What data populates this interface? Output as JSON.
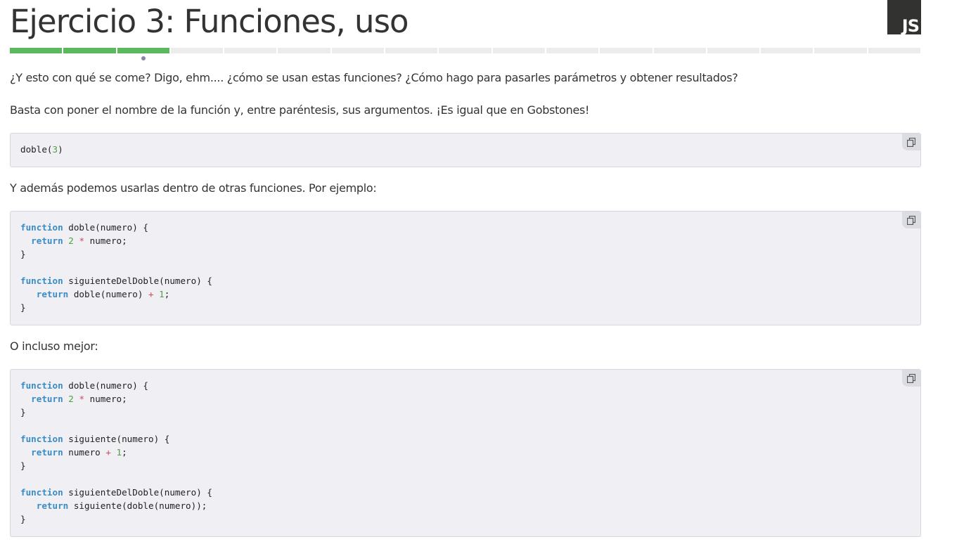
{
  "header": {
    "title": "Ejercicio 3: Funciones, uso",
    "language_badge": "JS"
  },
  "progress": {
    "total_steps": 17,
    "completed_steps": 3,
    "current_step": 3,
    "done_color": "#5cb85c",
    "pending_color": "#ececec"
  },
  "content": {
    "intro": "¿Y esto con qué se come? Digo, ehm.... ¿cómo se usan estas funciones? ¿Cómo hago para pasarles parámetros y obtener resultados?",
    "explanation": "Basta con poner el nombre de la función y, entre paréntesis, sus argumentos. ¡Es igual que en Gobstones!",
    "example_intro": "Y además podemos usarlas dentro de otras funciones. Por ejemplo:",
    "better_intro": "O incluso mejor:"
  },
  "code_blocks": [
    {
      "id": "call",
      "lines": [
        [
          [
            "plain",
            "doble("
          ],
          [
            "num",
            "3"
          ],
          [
            "plain",
            ")"
          ]
        ]
      ]
    },
    {
      "id": "example",
      "lines": [
        [
          [
            "kw",
            "function"
          ],
          [
            "plain",
            " doble(numero) {"
          ]
        ],
        [
          [
            "plain",
            "  "
          ],
          [
            "kw",
            "return"
          ],
          [
            "plain",
            " "
          ],
          [
            "num",
            "2"
          ],
          [
            "plain",
            " "
          ],
          [
            "op",
            "*"
          ],
          [
            "plain",
            " numero;"
          ]
        ],
        [
          [
            "plain",
            "}"
          ]
        ],
        [
          [
            "plain",
            ""
          ]
        ],
        [
          [
            "kw",
            "function"
          ],
          [
            "plain",
            " siguienteDelDoble(numero) {"
          ]
        ],
        [
          [
            "plain",
            "   "
          ],
          [
            "kw",
            "return"
          ],
          [
            "plain",
            " doble(numero) "
          ],
          [
            "op",
            "+"
          ],
          [
            "plain",
            " "
          ],
          [
            "num",
            "1"
          ],
          [
            "plain",
            ";"
          ]
        ],
        [
          [
            "plain",
            "}"
          ]
        ]
      ]
    },
    {
      "id": "better",
      "lines": [
        [
          [
            "kw",
            "function"
          ],
          [
            "plain",
            " doble(numero) {"
          ]
        ],
        [
          [
            "plain",
            "  "
          ],
          [
            "kw",
            "return"
          ],
          [
            "plain",
            " "
          ],
          [
            "num",
            "2"
          ],
          [
            "plain",
            " "
          ],
          [
            "op",
            "*"
          ],
          [
            "plain",
            " numero;"
          ]
        ],
        [
          [
            "plain",
            "}"
          ]
        ],
        [
          [
            "plain",
            ""
          ]
        ],
        [
          [
            "kw",
            "function"
          ],
          [
            "plain",
            " siguiente(numero) {"
          ]
        ],
        [
          [
            "plain",
            "  "
          ],
          [
            "kw",
            "return"
          ],
          [
            "plain",
            " numero "
          ],
          [
            "op",
            "+"
          ],
          [
            "plain",
            " "
          ],
          [
            "num",
            "1"
          ],
          [
            "plain",
            ";"
          ]
        ],
        [
          [
            "plain",
            "}"
          ]
        ],
        [
          [
            "plain",
            ""
          ]
        ],
        [
          [
            "kw",
            "function"
          ],
          [
            "plain",
            " siguienteDelDoble(numero) {"
          ]
        ],
        [
          [
            "plain",
            "   "
          ],
          [
            "kw",
            "return"
          ],
          [
            "plain",
            " siguiente(doble(numero));"
          ]
        ],
        [
          [
            "plain",
            "}"
          ]
        ]
      ]
    }
  ],
  "copy_button": {
    "icon": "copy-icon"
  },
  "colors": {
    "keyword": "#3a8cc4",
    "number": "#4f9e45",
    "operator": "#d34a5e",
    "code_background": "#efeff4"
  }
}
